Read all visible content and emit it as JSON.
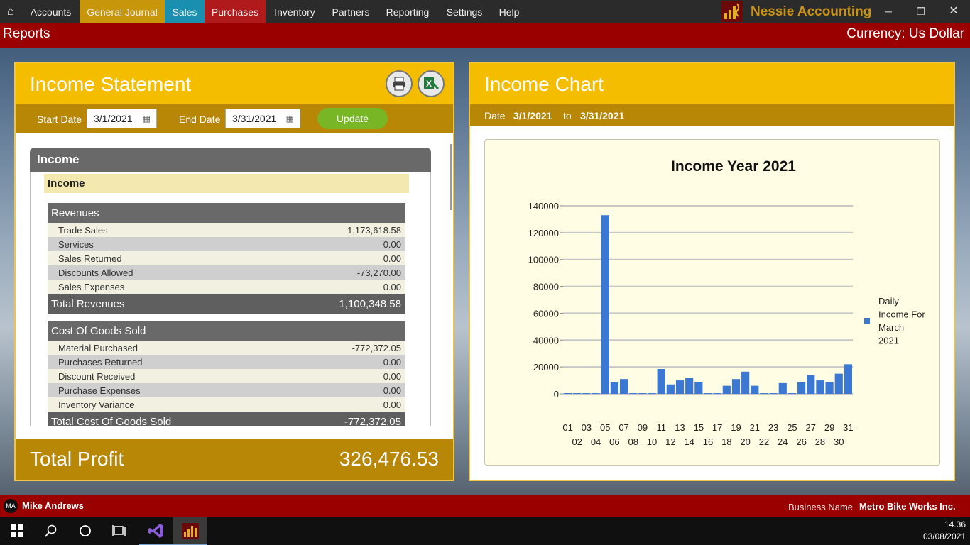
{
  "menu": {
    "items": [
      "Accounts",
      "General Journal",
      "Sales",
      "Purchases",
      "Inventory",
      "Partners",
      "Reporting",
      "Settings",
      "Help"
    ]
  },
  "app_title": "Nessie Accounting",
  "header": {
    "title": "Reports",
    "currency": "Currency: Us Dollar"
  },
  "income_statement": {
    "title": "Income Statement",
    "start_label": "Start Date",
    "start_value": "3/1/2021",
    "end_label": "End Date",
    "end_value": "3/31/2021",
    "update_label": "Update",
    "group_title": "Income",
    "subgroup_title": "Income",
    "revenues": {
      "title": "Revenues",
      "lines": [
        {
          "name": "Trade Sales",
          "value": "1,173,618.58"
        },
        {
          "name": "Services",
          "value": "0.00"
        },
        {
          "name": "Sales Returned",
          "value": "0.00"
        },
        {
          "name": "Discounts Allowed",
          "value": "-73,270.00"
        },
        {
          "name": "Sales Expenses",
          "value": "0.00"
        }
      ],
      "total_label": "Total Revenues",
      "total_value": "1,100,348.58"
    },
    "cogs": {
      "title": "Cost Of Goods Sold",
      "lines": [
        {
          "name": "Material Purchased",
          "value": "-772,372.05"
        },
        {
          "name": "Purchases Returned",
          "value": "0.00"
        },
        {
          "name": "Discount Received",
          "value": "0.00"
        },
        {
          "name": "Purchase Expenses",
          "value": "0.00"
        },
        {
          "name": "Inventory Variance",
          "value": "0.00"
        }
      ],
      "total_label": "Total Cost Of Goods Sold",
      "total_value": "-772,372.05"
    },
    "profit_label": "Total Profit",
    "profit_value": "326,476.53"
  },
  "income_chart_panel": {
    "title": "Income Chart",
    "date_label": "Date",
    "from": "3/1/2021",
    "to_label": "to",
    "to": "3/31/2021"
  },
  "chart_data": {
    "type": "bar",
    "title": "Income Year 2021",
    "xlabel": "",
    "ylabel": "",
    "categories": [
      "01",
      "02",
      "03",
      "04",
      "05",
      "06",
      "07",
      "08",
      "09",
      "10",
      "11",
      "12",
      "13",
      "14",
      "15",
      "16",
      "17",
      "18",
      "19",
      "20",
      "21",
      "22",
      "23",
      "24",
      "25",
      "26",
      "27",
      "28",
      "29",
      "30",
      "31"
    ],
    "series": [
      {
        "name": "Daily Income For March 2021",
        "values": [
          500,
          500,
          500,
          500,
          133000,
          8500,
          11000,
          500,
          500,
          500,
          18500,
          7000,
          10000,
          12000,
          9000,
          500,
          500,
          6000,
          11000,
          16500,
          6000,
          500,
          500,
          8000,
          500,
          8500,
          14000,
          10000,
          8500,
          15000,
          22000
        ]
      }
    ],
    "ylim": [
      0,
      140000
    ],
    "yticks": [
      0,
      20000,
      40000,
      60000,
      80000,
      100000,
      120000,
      140000
    ],
    "grid": true,
    "legend_position": "right",
    "color": "#3a78d4"
  },
  "footer": {
    "initials": "MA",
    "user": "Mike Andrews",
    "business_label": "Business Name",
    "business_name": "Metro Bike Works Inc."
  },
  "taskbar": {
    "time": "14.36",
    "date": "03/08/2021"
  }
}
